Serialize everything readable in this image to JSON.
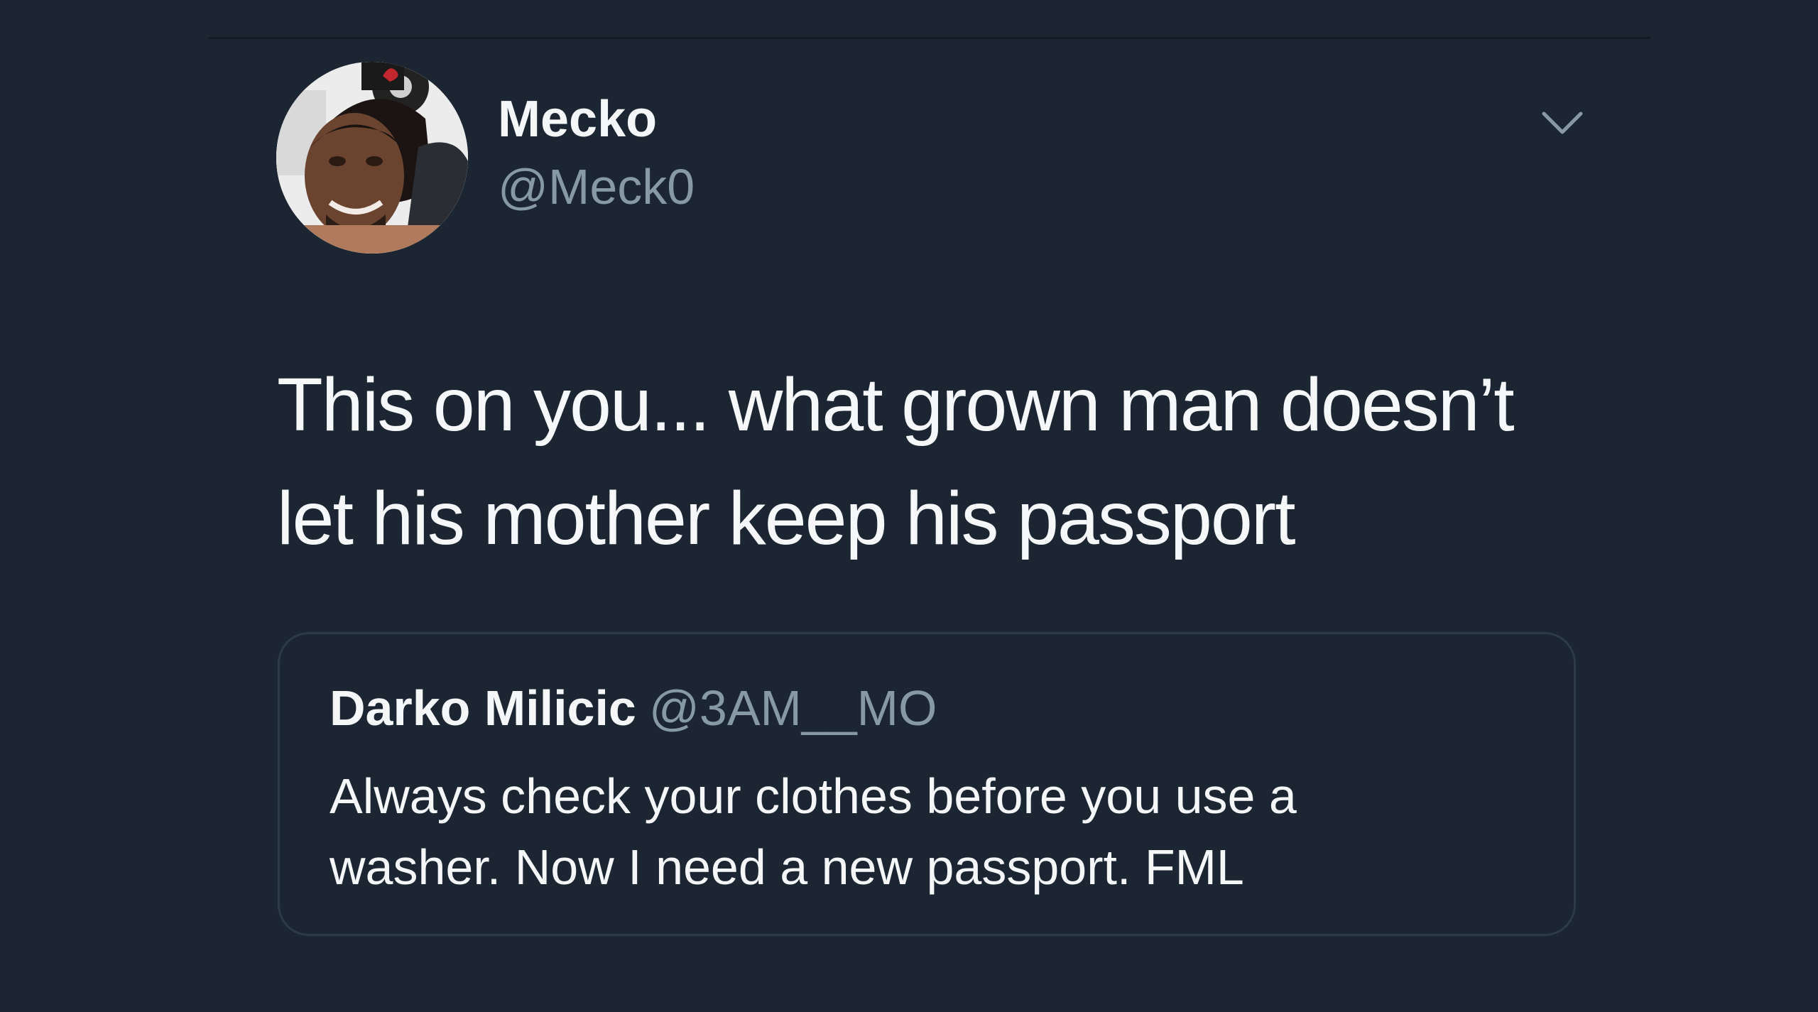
{
  "tweet": {
    "author_name": "Mecko",
    "author_handle": "@Meck0",
    "menu_icon": "chevron-down-icon",
    "avatar_icon": "avatar",
    "text_lines": [
      "This on you... what grown man doesn’t",
      "let his mother keep his passport"
    ]
  },
  "quoted_tweet": {
    "author_name": "Darko Milicic",
    "author_handle": "@3AM__MO",
    "text_lines": [
      "Always check your clothes before you use a",
      "washer. Now I need a new passport. FML"
    ]
  },
  "colors": {
    "background": "#1c2632",
    "primary_text": "#f4f6f8",
    "secondary_text": "#8899a6",
    "card_border": "#2e3a47"
  }
}
